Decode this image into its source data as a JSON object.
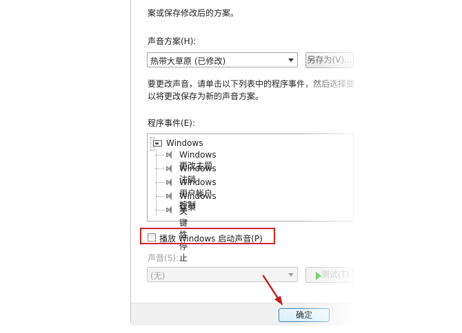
{
  "dialog": {
    "top_text": "案或保存修改后的方案。",
    "scheme_label": "声音方案(H):",
    "scheme_value": "热带大草原 (已修改)",
    "save_as_label": "另存为(V)...",
    "instructions_line1": "要更改声音，请单击以下列表中的程序事件，然后选择要",
    "instructions_line2": "以将更改保存为新的声音方案。",
    "events_label": "程序事件(E):",
    "events": {
      "root": "Windows",
      "items": [
        "Windows 更改主题",
        "Windows 注销",
        "Windows 用户帐户控制",
        "Windows 登录",
        "关键性停止"
      ]
    },
    "startup_checkbox_label": "播放 Windows 启动声音(P)",
    "startup_checked": false,
    "sound_label": "声音(S):",
    "sound_value": "(无)",
    "test_label": "测试(T)",
    "ok_label": "确定"
  },
  "annotations": {
    "highlight_color": "#d12020"
  }
}
